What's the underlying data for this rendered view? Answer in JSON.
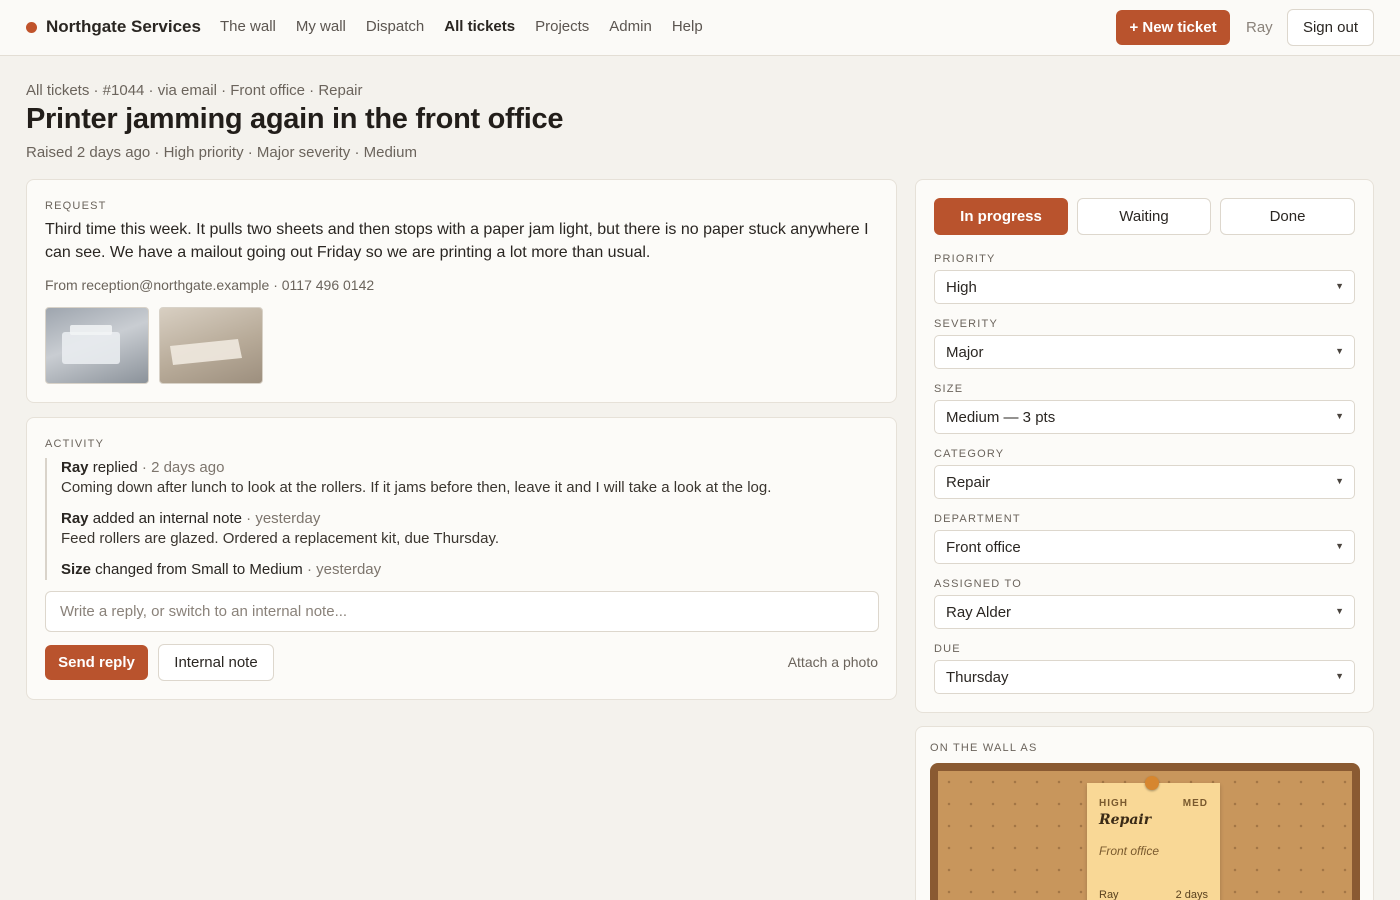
{
  "brand": {
    "name": "Northgate Services",
    "dot_color": "#c0532b"
  },
  "nav": [
    "The wall",
    "My wall",
    "Dispatch",
    "All tickets",
    "Projects",
    "Admin",
    "Help"
  ],
  "nav_active": "All tickets",
  "header_actions": {
    "new_ticket": "+ New ticket",
    "user": "Ray",
    "sign_out": "Sign out"
  },
  "ticket": {
    "breadcrumb": "All tickets · #1044 · via email · Front office · Repair",
    "title": "Printer jamming again in the front office",
    "subtitle": "Raised 2 days ago · High priority · Major severity · Medium"
  },
  "request": {
    "label": "Request",
    "text": "Third time this week. It pulls two sheets and then stops with a paper jam light, but there is no paper stuck anywhere I can see. We have a mailout going out Friday so we are printing a lot more than usual.",
    "from": "From reception@northgate.example · 0117 496 0142"
  },
  "activity": {
    "label": "Activity",
    "entries": [
      {
        "who": "Ray",
        "action": " replied",
        "when": " · 2 days ago",
        "body": "Coming down after lunch to look at the rollers. If it jams before then, leave it and I will take a look at the log."
      },
      {
        "who": "Ray",
        "action": " added an internal note",
        "when": " · yesterday",
        "body": "Feed rollers are glazed. Ordered a replacement kit, due Thursday."
      },
      {
        "who": "Size",
        "action": " changed from Small to Medium",
        "when": " · yesterday",
        "body": ""
      }
    ],
    "reply_placeholder": "Write a reply, or switch to an internal note...",
    "send_label": "Send reply",
    "note_label": "Internal note",
    "attach_label": "Attach a photo"
  },
  "status": {
    "options": [
      "In progress",
      "Waiting",
      "Done"
    ],
    "active": "In progress",
    "accent": "#b9532d"
  },
  "fields": {
    "priority": {
      "label": "Priority",
      "value": "High"
    },
    "severity": {
      "label": "Severity",
      "value": "Major"
    },
    "size": {
      "label": "Size",
      "value": "Medium — 3 pts"
    },
    "category": {
      "label": "Category",
      "value": "Repair"
    },
    "department": {
      "label": "Department",
      "value": "Front office"
    },
    "assigned": {
      "label": "Assigned to",
      "value": "Ray Alder"
    },
    "due": {
      "label": "Due",
      "value": "Thursday"
    }
  },
  "wall": {
    "label": "On the wall as",
    "sticky": {
      "priority": "HIGH",
      "size": "MED",
      "category": "Repair",
      "department": "Front office",
      "who": "Ray",
      "age": "2 days"
    }
  }
}
